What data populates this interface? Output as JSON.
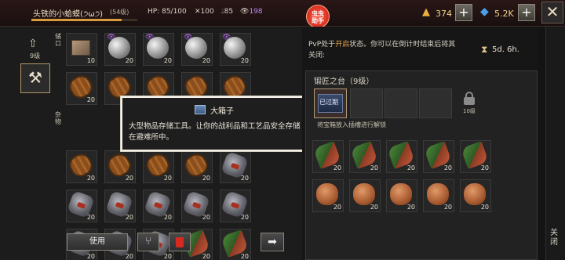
{
  "player": {
    "name": "头铁的小蛤蟆(੭ω੭)",
    "tag": "(54级)",
    "xp_fraction": 0.85
  },
  "stats": {
    "hp": "HP: 85/100",
    "food": "100",
    "water": "85",
    "radiation": "198"
  },
  "assist_badge": "虫虫\n助手",
  "resources": {
    "gold": "374",
    "gems": "5.2K",
    "plus": "+"
  },
  "close_x": "✕",
  "left": {
    "level_arrow": "⇧",
    "level_label": "9级",
    "anvil_glyph": "⚒",
    "label_top": "储口",
    "label_bottom": "杂物",
    "grid": [
      [
        {
          "item": "crate",
          "count": "10"
        },
        {
          "item": "orb",
          "count": "20",
          "eye": true
        },
        {
          "item": "orb",
          "count": "20",
          "eye": true
        },
        {
          "item": "orb",
          "count": "20",
          "eye": true
        },
        {
          "item": "orb",
          "count": "20",
          "eye": true
        }
      ],
      [
        {
          "item": "barrel",
          "count": "20"
        },
        {
          "item": "barrel",
          "count": "20"
        },
        {
          "item": "barrel",
          "count": "20"
        },
        {
          "item": "barrel",
          "count": "20"
        },
        {
          "item": "barrel",
          "count": "20"
        }
      ],
      [
        {
          "item": "",
          "count": ""
        },
        {
          "item": "",
          "count": ""
        },
        {
          "item": "",
          "count": ""
        },
        {
          "item": "",
          "count": ""
        },
        {
          "item": "",
          "count": ""
        }
      ],
      [
        {
          "item": "barrel",
          "count": "20"
        },
        {
          "item": "barrel",
          "count": "20"
        },
        {
          "item": "barrel",
          "count": "20"
        },
        {
          "item": "barrel",
          "count": "20"
        },
        {
          "item": "ore",
          "count": "20"
        }
      ],
      [
        {
          "item": "ore",
          "count": "20"
        },
        {
          "item": "ore",
          "count": "20"
        },
        {
          "item": "ore",
          "count": "20"
        },
        {
          "item": "ore",
          "count": "20"
        },
        {
          "item": "ore",
          "count": "20"
        }
      ],
      [
        {
          "item": "ore",
          "count": "20"
        },
        {
          "item": "ore",
          "count": "20"
        },
        {
          "item": "ore",
          "count": "20"
        },
        {
          "item": "herb",
          "count": "20"
        },
        {
          "item": "herb",
          "count": "20"
        }
      ]
    ],
    "use_label": "使用",
    "split_glyph": "⑂",
    "move_glyph": "➡"
  },
  "tooltip": {
    "title": "大箱子",
    "description": "大型物品存储工具。让你的战利品和工艺品安全存储在避难所中。"
  },
  "right": {
    "pvp_prefix": "PvP处于",
    "pvp_state": "开启",
    "pvp_suffix": "状态。你可以在倒计时结束后将其关闭:",
    "hourglass": "⧗",
    "shield_time": "5d. 6h.",
    "anvil_title": "锻匠之台（9级）",
    "expired_label": "已过期",
    "lock_level": "10级",
    "unlock_hint": "将宝箱放入插槽进行解锁",
    "grid": [
      [
        {
          "item": "herb",
          "count": "20"
        },
        {
          "item": "herb",
          "count": "20"
        },
        {
          "item": "herb",
          "count": "20"
        },
        {
          "item": "herb",
          "count": "20"
        },
        {
          "item": "herb",
          "count": "20"
        }
      ],
      [
        {
          "item": "meat",
          "count": "20"
        },
        {
          "item": "meat",
          "count": "20"
        },
        {
          "item": "meat",
          "count": "20"
        },
        {
          "item": "meat",
          "count": "20"
        },
        {
          "item": "meat",
          "count": "20"
        }
      ]
    ],
    "close_label": "关闭"
  }
}
